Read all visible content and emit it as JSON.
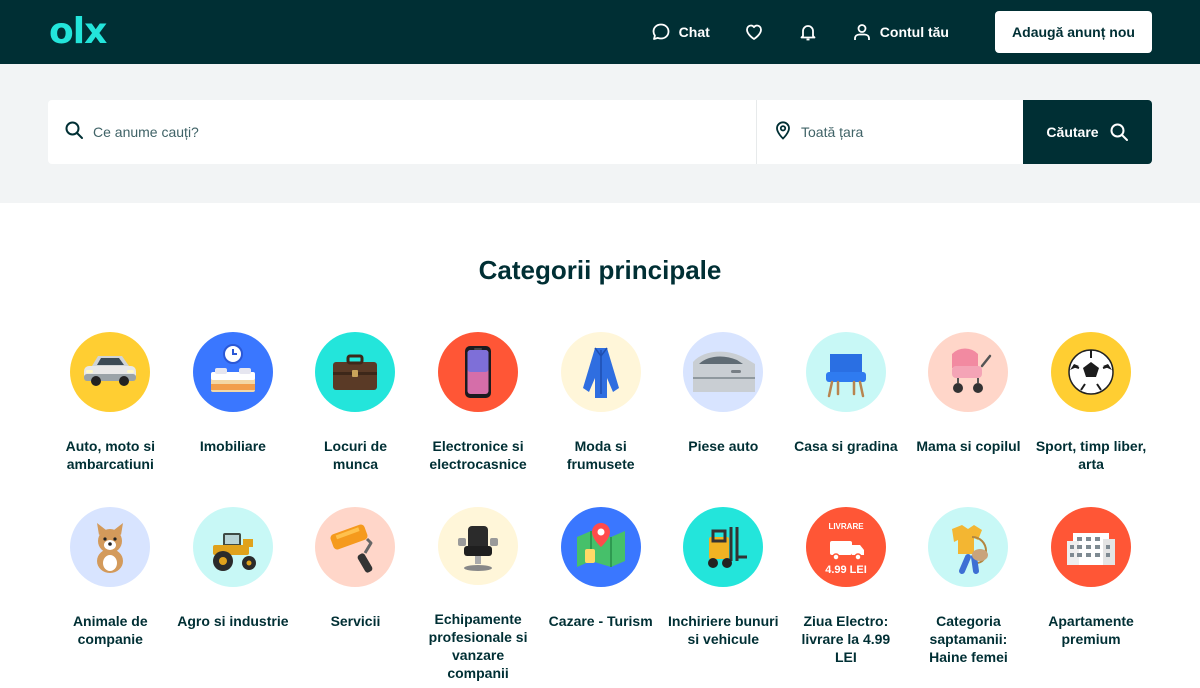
{
  "header": {
    "logo_text": "olx",
    "chat_label": "Chat",
    "account_label": "Contul tău",
    "post_ad_label": "Adaugă anunț nou"
  },
  "search": {
    "query_placeholder": "Ce anume cauți?",
    "location_placeholder": "Toată țara",
    "button_label": "Căutare"
  },
  "categories_section": {
    "title": "Categorii principale",
    "items": [
      {
        "label": "Auto, moto si ambarcatiuni",
        "icon": "car-icon",
        "bg": "#ffce32"
      },
      {
        "label": "Imobiliare",
        "icon": "bedroom-icon",
        "bg": "#3a77ff"
      },
      {
        "label": "Locuri de munca",
        "icon": "briefcase-icon",
        "bg": "#23e5db"
      },
      {
        "label": "Electronice si electrocasnice",
        "icon": "smartphone-icon",
        "bg": "#ff5636"
      },
      {
        "label": "Moda si frumusete",
        "icon": "dress-icon",
        "bg": "#fff6d9"
      },
      {
        "label": "Piese auto",
        "icon": "car-door-icon",
        "bg": "#d8e4ff"
      },
      {
        "label": "Casa si gradina",
        "icon": "armchair-icon",
        "bg": "#c8f8f6"
      },
      {
        "label": "Mama si copilul",
        "icon": "stroller-icon",
        "bg": "#ffd6c9"
      },
      {
        "label": "Sport, timp liber, arta",
        "icon": "football-icon",
        "bg": "#ffce32"
      },
      {
        "label": "Animale de companie",
        "icon": "dog-icon",
        "bg": "#d8e4ff"
      },
      {
        "label": "Agro si industrie",
        "icon": "tractor-icon",
        "bg": "#c8f8f6"
      },
      {
        "label": "Servicii",
        "icon": "paint-roller-icon",
        "bg": "#ffd6c9"
      },
      {
        "label": "Echipamente profesionale si vanzare companii",
        "icon": "barber-chair-icon",
        "bg": "#fff6d9"
      },
      {
        "label": "Cazare - Turism",
        "icon": "map-pin-icon",
        "bg": "#3a77ff"
      },
      {
        "label": "Inchiriere bunuri si vehicule",
        "icon": "forklift-icon",
        "bg": "#23e5db"
      },
      {
        "label": "Ziua Electro: livrare la 4.99 LEI",
        "icon": "delivery-truck-icon",
        "bg": "#ff5636",
        "badge_top": "LIVRARE",
        "badge_price": "4.99 LEI"
      },
      {
        "label": "Categoria saptamanii: Haine femei",
        "icon": "clothes-icon",
        "bg": "#c8f8f6"
      },
      {
        "label": "Apartamente premium",
        "icon": "apartment-building-icon",
        "bg": "#ff5636"
      }
    ]
  }
}
